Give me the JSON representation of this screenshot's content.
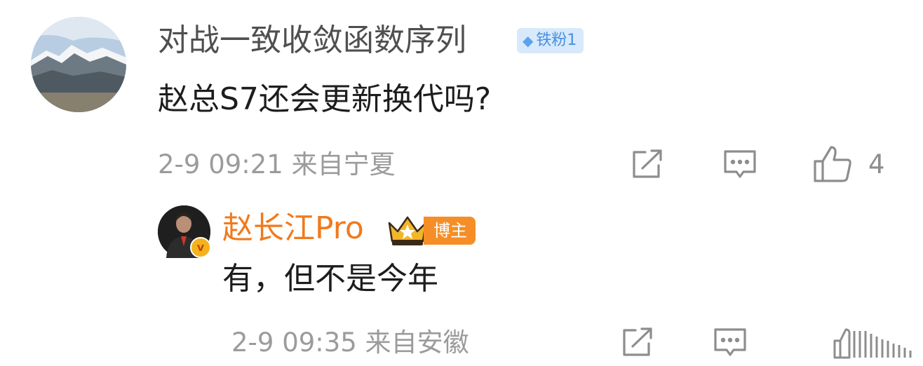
{
  "comment": {
    "username": "对战一致收敛函数序列",
    "fan_badge": "铁粉1",
    "text": "赵总S7还会更新换代吗?",
    "meta": "2-9 09:21 来自宁夏",
    "like_count": "4"
  },
  "reply": {
    "username": "赵长江Pro",
    "role_badge": "博主",
    "text": "有，但不是今年",
    "meta": "2-9 09:35 来自安徽"
  },
  "colors": {
    "username_gray": "#4f4f4f",
    "username_orange": "#f07a1d",
    "meta_gray": "#9b9b9b",
    "icon_gray": "#8d8d8d",
    "fan_badge_bg": "#d7e9fb",
    "blogger_badge_bg": "#f58e26"
  },
  "icons": [
    "share-icon",
    "comment-icon",
    "thumbs-up-icon",
    "diamond-icon",
    "crown-icon",
    "verified-icon"
  ]
}
